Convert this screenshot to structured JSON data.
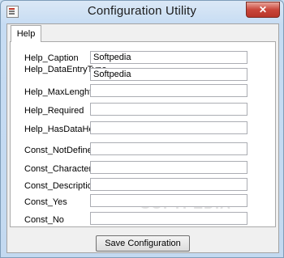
{
  "window": {
    "title": "Configuration Utility",
    "close_glyph": "✕"
  },
  "tabs": [
    {
      "label": "Help",
      "selected": true
    }
  ],
  "fields": [
    {
      "label": "Help_Caption",
      "value": "Softpedia"
    },
    {
      "label": "Help_DataEntryType",
      "value": "Softpedia"
    },
    {
      "label": "Help_MaxLenght",
      "value": ""
    },
    {
      "label": "Help_Required",
      "value": ""
    },
    {
      "label": "Help_HasDataHelp",
      "value": ""
    },
    {
      "label": "Const_NotDefined",
      "value": ""
    },
    {
      "label": "Const_Characters",
      "value": ""
    },
    {
      "label": "Const_Description",
      "value": ""
    },
    {
      "label": "Const_Yes",
      "value": ""
    },
    {
      "label": "Const_No",
      "value": ""
    }
  ],
  "watermark": "SOFTPEDIA",
  "save_button": {
    "label": "Save Configuration"
  }
}
